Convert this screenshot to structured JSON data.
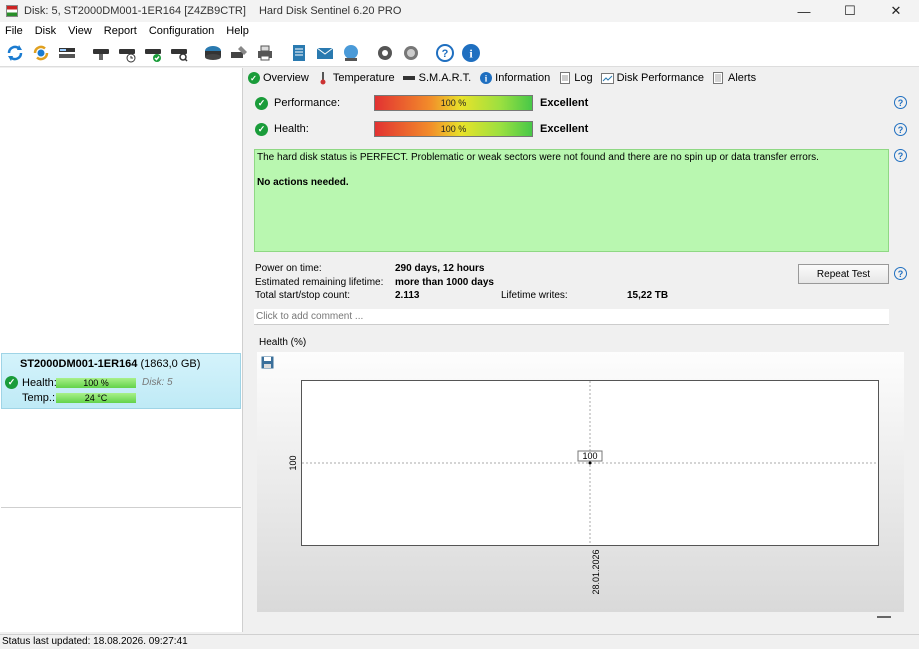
{
  "window": {
    "title_disk": "Disk: 5, ST2000DM001-1ER164 [Z4ZB9CTR]",
    "title_app": "Hard Disk Sentinel 6.20 PRO",
    "minimize": "—",
    "maximize": "☐",
    "close": "✕"
  },
  "menu": [
    "File",
    "Disk",
    "View",
    "Report",
    "Configuration",
    "Help"
  ],
  "toolbar_icons": [
    "refresh-icon",
    "refresh-warning-icon",
    "disk-list-icon",
    "disk-test-icon",
    "disk-schedule-icon",
    "disk-ok-icon",
    "disk-search-icon",
    "backup-icon",
    "disk-tools-icon",
    "printer-icon",
    "report-icon",
    "email-icon",
    "network-icon",
    "settings-icon",
    "sound-icon",
    "help-icon",
    "info-icon"
  ],
  "disk": {
    "model": "ST2000DM001-1ER164",
    "capacity": "(1863,0 GB)",
    "health_label": "Health:",
    "health_value": "100 %",
    "disk_label": "Disk: 5",
    "temp_label": "Temp.:",
    "temp_value": "24 °C"
  },
  "tabs": [
    {
      "label": "Overview",
      "icon": "check-icon"
    },
    {
      "label": "Temperature",
      "icon": "thermometer-icon"
    },
    {
      "label": "S.M.A.R.T.",
      "icon": "disk-icon"
    },
    {
      "label": "Information",
      "icon": "info-icon"
    },
    {
      "label": "Log",
      "icon": "log-icon"
    },
    {
      "label": "Disk Performance",
      "icon": "performance-icon"
    },
    {
      "label": "Alerts",
      "icon": "alerts-icon"
    }
  ],
  "overview": {
    "performance_label": "Performance:",
    "performance_value": "100 %",
    "performance_rating": "Excellent",
    "health_label": "Health:",
    "health_value": "100 %",
    "health_rating": "Excellent",
    "status_message": "The hard disk status is PERFECT. Problematic or weak sectors were not found and there are no spin up or data transfer errors.",
    "action_message": "No actions needed.",
    "power_on_label": "Power on time:",
    "power_on_value": "290 days, 12 hours",
    "lifetime_label": "Estimated remaining lifetime:",
    "lifetime_value": "more than 1000 days",
    "startstop_label": "Total start/stop count:",
    "startstop_value": "2.113",
    "writes_label": "Lifetime writes:",
    "writes_value": "15,22 TB",
    "repeat_test": "Repeat Test",
    "comment_placeholder": "Click to add comment ..."
  },
  "chart_data": {
    "type": "line",
    "title": "Health (%)",
    "x": [
      "28.01.2026"
    ],
    "series": [
      {
        "values": [
          100
        ]
      }
    ],
    "ytick": "100",
    "point_label": "100",
    "grid": true
  },
  "statusbar": {
    "text": "Status last updated: 18.08.2026. 09:27:41"
  }
}
